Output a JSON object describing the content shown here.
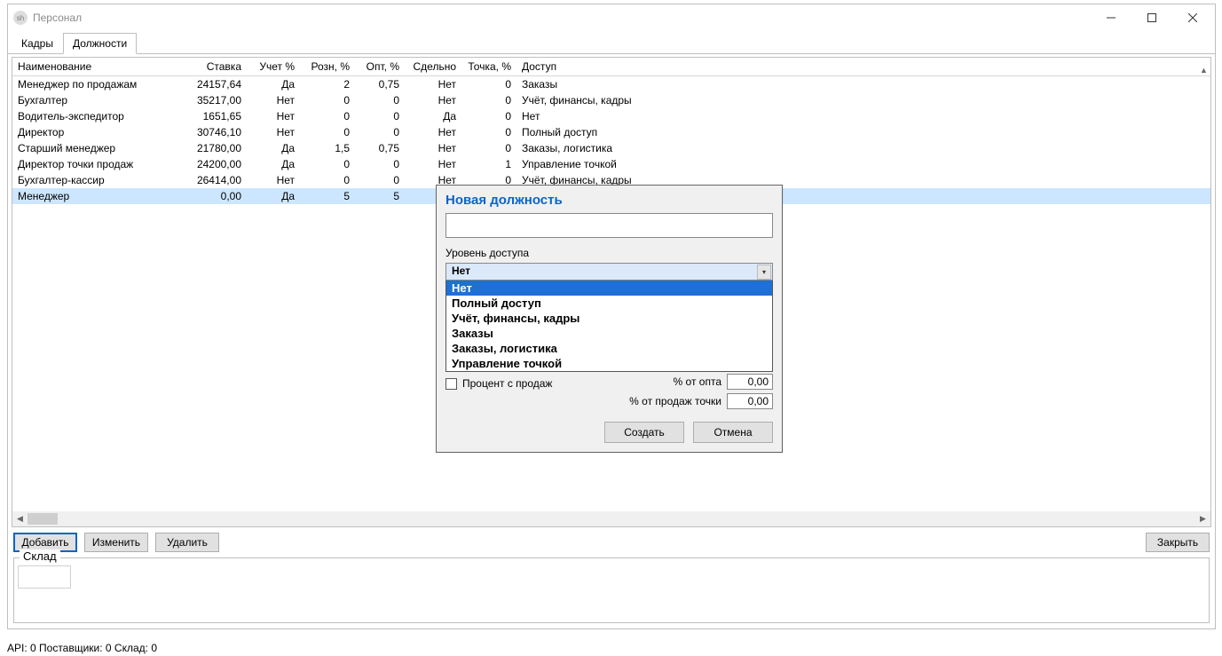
{
  "window": {
    "icon_text": "sh",
    "title": "Персонал"
  },
  "tabs": {
    "t0": "Кадры",
    "t1": "Должности"
  },
  "columns": {
    "name": "Наименование",
    "rate": "Ставка",
    "uchet": "Учет %",
    "rozn": "Розн, %",
    "opt": "Опт, %",
    "sdelno": "Сдельно",
    "tochka": "Точка, %",
    "access": "Доступ"
  },
  "rows": [
    {
      "name": "Менеджер по продажам",
      "rate": "24157,64",
      "uchet": "Да",
      "rozn": "2",
      "opt": "0,75",
      "sdelno": "Нет",
      "tochka": "0",
      "access": "Заказы"
    },
    {
      "name": "Бухгалтер",
      "rate": "35217,00",
      "uchet": "Нет",
      "rozn": "0",
      "opt": "0",
      "sdelno": "Нет",
      "tochka": "0",
      "access": "Учёт, финансы, кадры"
    },
    {
      "name": "Водитель-экспедитор",
      "rate": "1651,65",
      "uchet": "Нет",
      "rozn": "0",
      "opt": "0",
      "sdelno": "Да",
      "tochka": "0",
      "access": "Нет"
    },
    {
      "name": "Директор",
      "rate": "30746,10",
      "uchet": "Нет",
      "rozn": "0",
      "opt": "0",
      "sdelno": "Нет",
      "tochka": "0",
      "access": "Полный доступ"
    },
    {
      "name": "Старший менеджер",
      "rate": "21780,00",
      "uchet": "Да",
      "rozn": "1,5",
      "opt": "0,75",
      "sdelno": "Нет",
      "tochka": "0",
      "access": "Заказы, логистика"
    },
    {
      "name": "Директор точки продаж",
      "rate": "24200,00",
      "uchet": "Да",
      "rozn": "0",
      "opt": "0",
      "sdelno": "Нет",
      "tochka": "1",
      "access": "Управление точкой"
    },
    {
      "name": "Бухгалтер-кассир",
      "rate": "26414,00",
      "uchet": "Нет",
      "rozn": "0",
      "opt": "0",
      "sdelno": "Нет",
      "tochka": "0",
      "access": "Учёт, финансы, кадры"
    },
    {
      "name": "Менеджер",
      "rate": "0,00",
      "uchet": "Да",
      "rozn": "5",
      "opt": "5",
      "sdelno": "",
      "tochka": "",
      "access": ""
    }
  ],
  "buttons": {
    "add": "Добавить",
    "edit": "Изменить",
    "del": "Удалить",
    "close": "Закрыть"
  },
  "sklad_label": "Склад",
  "status": "API: 0  Поставщики: 0  Склад: 0",
  "dialog": {
    "title": "Новая должность",
    "access_label": "Уровень доступа",
    "combo_value": "Нет",
    "options": [
      "Нет",
      "Полный доступ",
      "Учёт, финансы, кадры",
      "Заказы",
      "Заказы, логистика",
      "Управление точкой"
    ],
    "chk_label": "Процент с продаж",
    "pct_opt_label": "% от опта",
    "pct_opt_val": "0,00",
    "pct_point_label": "% от продаж точки",
    "pct_point_val": "0,00",
    "create": "Создать",
    "cancel": "Отмена"
  }
}
